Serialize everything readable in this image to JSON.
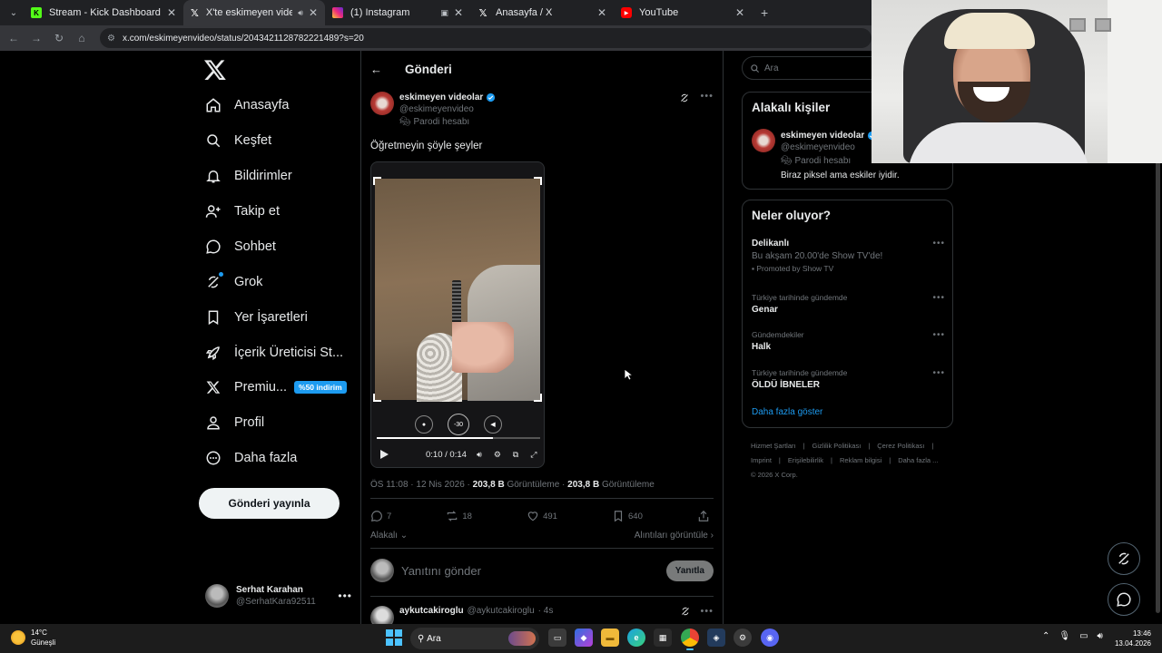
{
  "browser": {
    "tabs": [
      {
        "title": "Stream - Kick Dashboard",
        "favicon": "kick-icon",
        "color": "#53fc18",
        "active": false
      },
      {
        "title": "X'te eskimeyen videolar: \"Ö",
        "favicon": "x-icon",
        "color": "#000000",
        "active": true
      },
      {
        "title": "(1) Instagram",
        "favicon": "instagram-icon",
        "color": "#e1306c",
        "active": false
      },
      {
        "title": "Anasayfa / X",
        "favicon": "x-icon",
        "color": "#000000",
        "active": false
      },
      {
        "title": "YouTube",
        "favicon": "youtube-icon",
        "color": "#ff0000",
        "active": false
      }
    ],
    "url": "x.com/eskimeyenvideo/status/2043421128782221489?s=20"
  },
  "nav": {
    "items": [
      {
        "label": "Anasayfa",
        "icon": "home-icon"
      },
      {
        "label": "Keşfet",
        "icon": "search-icon"
      },
      {
        "label": "Bildirimler",
        "icon": "bell-icon"
      },
      {
        "label": "Takip et",
        "icon": "follow-icon"
      },
      {
        "label": "Sohbet",
        "icon": "chat-icon"
      },
      {
        "label": "Grok",
        "icon": "grok-icon"
      },
      {
        "label": "Yer İşaretleri",
        "icon": "bookmark-icon"
      },
      {
        "label": "İçerik Üreticisi St...",
        "icon": "rocket-icon"
      },
      {
        "label": "Premiu...",
        "icon": "x-premium-icon",
        "badge": "%50 indirim"
      },
      {
        "label": "Profil",
        "icon": "profile-icon"
      },
      {
        "label": "Daha fazla",
        "icon": "more-circle-icon"
      }
    ],
    "post_button": "Gönderi yayınla",
    "account": {
      "name": "Serhat Karahan",
      "handle": "@SerhatKara92511"
    }
  },
  "main": {
    "header_title": "Gönderi",
    "post": {
      "author_name": "eskimeyen videolar",
      "author_handle": "@eskimeyenvideo",
      "author_label": "Parodi hesabı",
      "text": "Öğretmeyin şöyle şeyler",
      "video": {
        "time": "0:10 / 0:14",
        "progress": 0.71,
        "skip_label": "-30"
      },
      "meta_time": "ÖS 11:08 · 12 Nis 2026 · ",
      "views_1": "203,8 B",
      "views_label_1": " Görüntüleme · ",
      "views_2": "203,8 B",
      "views_label_2": " Görüntüleme",
      "replies": "7",
      "reposts": "18",
      "likes": "491",
      "bookmarks": "640",
      "related_label": "Alakalı",
      "quotes_label": "Alıntıları görüntüle"
    },
    "reply_placeholder": "Yanıtını gönder",
    "reply_button": "Yanıtla",
    "next_reply": {
      "name": "aykutcakiroglu",
      "handle": "@aykutcakiroglu",
      "time": "· 4s"
    }
  },
  "sidebar": {
    "search_placeholder": "Ara",
    "relevant_title": "Alakalı kişiler",
    "relevant_person": {
      "name": "eskimeyen videolar",
      "handle": "@eskimeyenvideo",
      "label": "Parodi hesabı",
      "bio": "Biraz piksel ama eskiler iyidir."
    },
    "trends_title": "Neler oluyor?",
    "trends": [
      {
        "context": "",
        "title": "Delikanlı",
        "subtitle": "Bu akşam 20.00'de Show TV'de!",
        "promo": "Promoted by Show TV"
      },
      {
        "context": "Türkiye tarihinde gündemde",
        "title": "Genar"
      },
      {
        "context": "Gündemdekiler",
        "title": "Halk"
      },
      {
        "context": "Türkiye tarihinde gündemde",
        "title": "ÖLDÜ İBNELER"
      }
    ],
    "show_more": "Daha fazla göster",
    "footer_links": [
      "Hizmet Şartları",
      "|",
      "Gizlilik Politikası",
      "|",
      "Çerez Politikası",
      "|",
      "Imprint",
      "|",
      "Erişilebilirlik",
      "|",
      "Reklam bilgisi",
      "|",
      "Daha fazla ...",
      "© 2026 X Corp."
    ]
  },
  "taskbar": {
    "weather_temp": "14°C",
    "weather_label": "Güneşli",
    "search_label": "Ara",
    "time": "13:46",
    "date": "13.04.2026"
  },
  "colors": {
    "accent": "#1d9bf0",
    "background": "#000000",
    "border": "#2f3336"
  }
}
